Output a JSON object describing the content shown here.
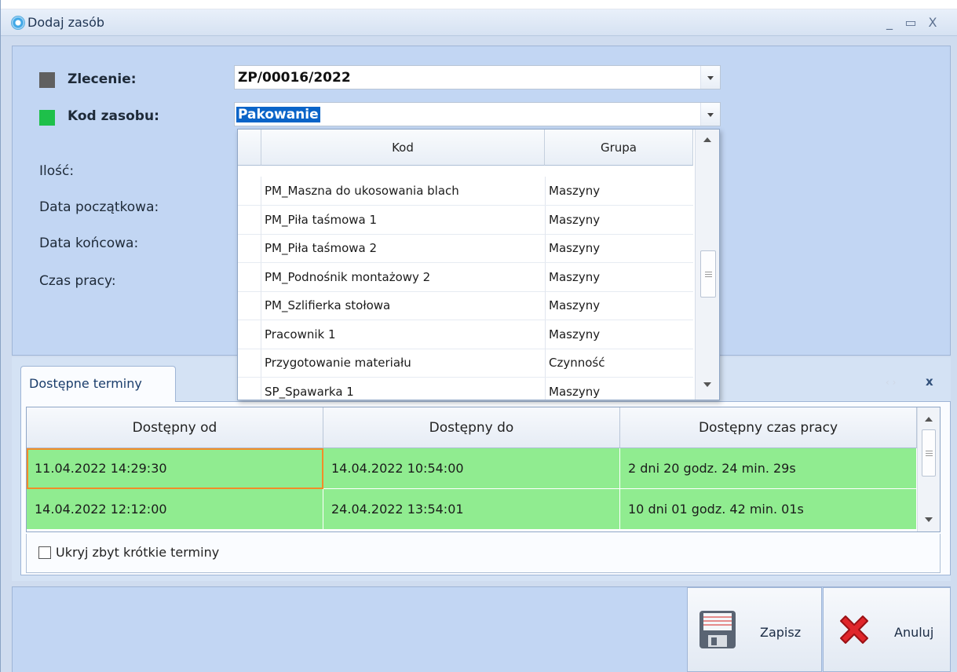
{
  "window": {
    "title": "Dodaj zasób",
    "controls": {
      "minimize": "_",
      "maximize": "▭",
      "close": "X"
    }
  },
  "form": {
    "zlecenie_label": "Zlecenie:",
    "zlecenie_value": "ZP/00016/2022",
    "zlecenie_color": "#606060",
    "kod_label": "Kod zasobu:",
    "kod_value": "Pakowanie",
    "kod_color": "#1ec04a",
    "ilosc_label": "Ilość:",
    "data_pocz_label": "Data początkowa:",
    "data_konc_label": "Data końcowa:",
    "czas_label": "Czas pracy:"
  },
  "dropdown": {
    "headers": {
      "kod": "Kod",
      "grupa": "Grupa"
    },
    "rows": [
      {
        "kod": "PM_Maszna do ukosowania blach",
        "grupa": "Maszyny"
      },
      {
        "kod": "PM_Piła taśmowa 1",
        "grupa": "Maszyny"
      },
      {
        "kod": "PM_Piła taśmowa 2",
        "grupa": "Maszyny"
      },
      {
        "kod": "PM_Podnośnik montażowy 2",
        "grupa": "Maszyny"
      },
      {
        "kod": "PM_Szlifierka stołowa",
        "grupa": "Maszyny"
      },
      {
        "kod": "Pracownik 1",
        "grupa": "Maszyny"
      },
      {
        "kod": "Przygotowanie materiału",
        "grupa": "Czynność"
      },
      {
        "kod": "SP_Spawarka 1",
        "grupa": "Maszyny"
      }
    ]
  },
  "tab": {
    "label": "Dostępne terminy",
    "close": "x",
    "nav": "‹ ›"
  },
  "grid": {
    "headers": {
      "od": "Dostępny od",
      "do": "Dostępny do",
      "czas": "Dostępny czas pracy"
    },
    "rows": [
      {
        "od": "11.04.2022 14:29:30",
        "do": "14.04.2022 10:54:00",
        "czas": "2 dni 20 godz. 24 min. 29s"
      },
      {
        "od": "14.04.2022 12:12:00",
        "do": "24.04.2022 13:54:01",
        "czas": "10 dni 01 godz. 42 min. 01s"
      }
    ],
    "row_color": "#90ec90"
  },
  "checkbox": {
    "label": "Ukryj zbyt krótkie terminy",
    "checked": false
  },
  "buttons": {
    "save": "Zapisz",
    "cancel": "Anuluj"
  }
}
